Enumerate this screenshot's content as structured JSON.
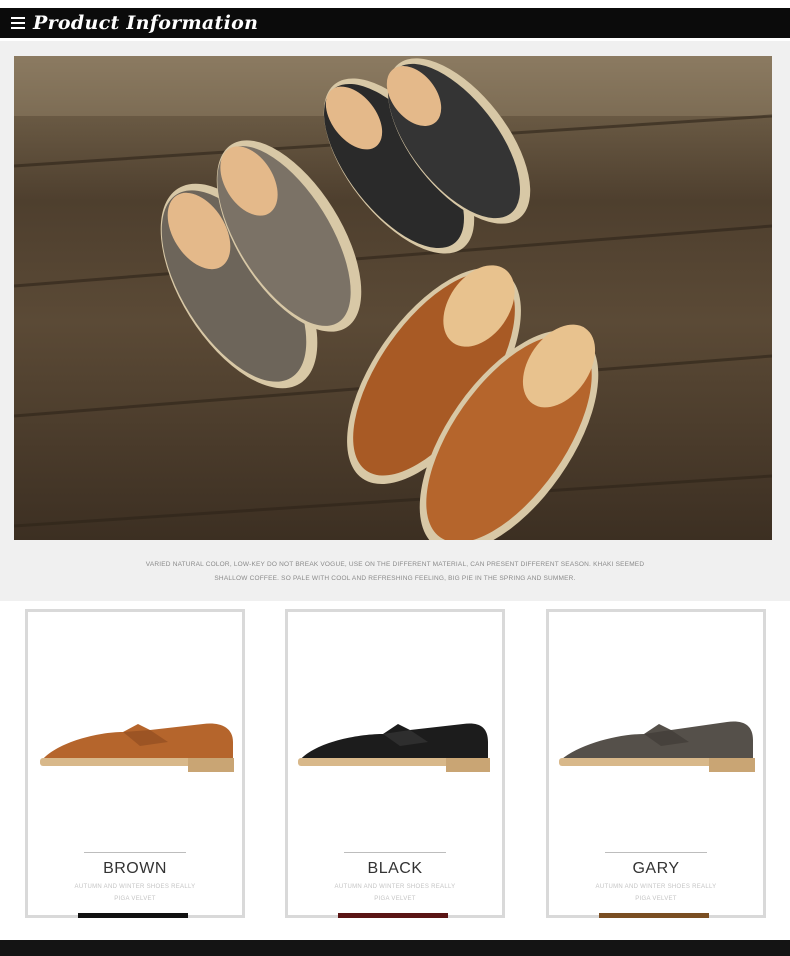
{
  "header": {
    "title": "Product Information",
    "menu_icon": "hamburger-icon"
  },
  "hero": {
    "caption_line1": "VARIED NATURAL COLOR, LOW-KEY DO NOT BREAK VOGUE, USE ON THE DIFFERENT MATERIAL, CAN PRESENT DIFFERENT SEASON. KHAKI SEEMED",
    "caption_line2": "SHALLOW COFFEE. SO PALE WITH COOL AND REFRESHING FEELING, BIG PIE IN THE SPRING AND SUMMER."
  },
  "variants": [
    {
      "name": "BROWN",
      "sub1": "AUTUMN AND WINTER SHOES REALLY",
      "sub2": "PIGA VELVET",
      "shoe_color": "#b5652c",
      "accent": "#111111"
    },
    {
      "name": "BLACK",
      "sub1": "AUTUMN AND WINTER SHOES REALLY",
      "sub2": "PIGA VELVET",
      "shoe_color": "#1c1c1c",
      "accent": "#5a1414"
    },
    {
      "name": "GARY",
      "sub1": "AUTUMN AND WINTER SHOES REALLY",
      "sub2": "PIGA VELVET",
      "shoe_color": "#55504a",
      "accent": "#7a4e22"
    }
  ]
}
